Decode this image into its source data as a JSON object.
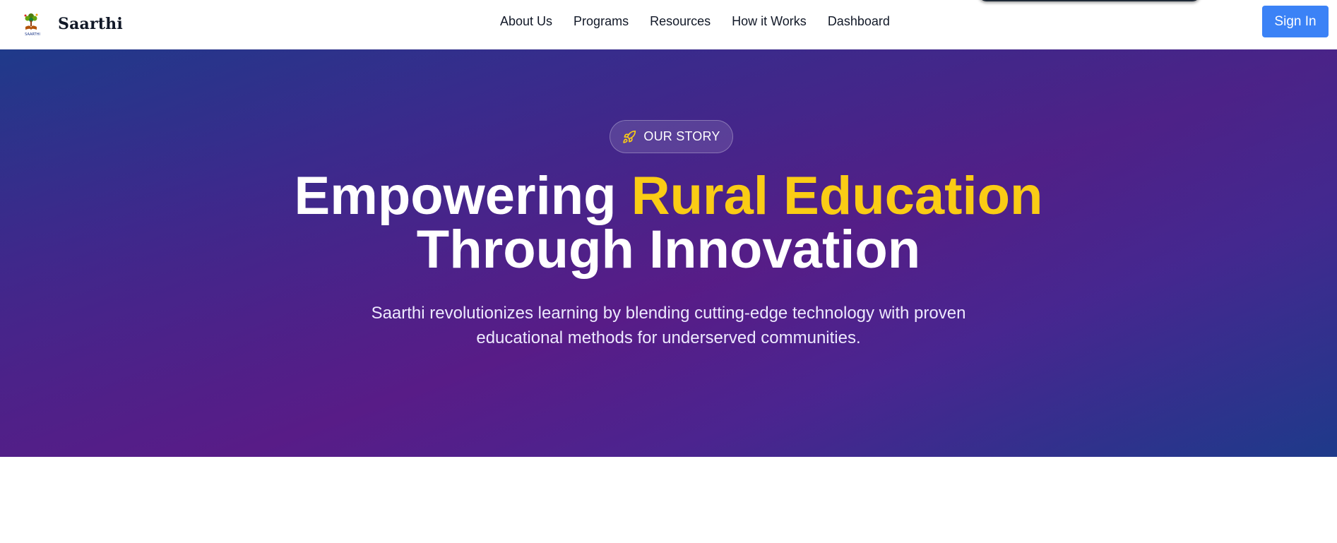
{
  "brand": {
    "name": "Saarthi",
    "logo_icon": "tree-book-logo",
    "logo_caption": "SAARTHI"
  },
  "nav": {
    "items": [
      {
        "label": "About Us"
      },
      {
        "label": "Programs"
      },
      {
        "label": "Resources"
      },
      {
        "label": "How it Works"
      },
      {
        "label": "Dashboard"
      }
    ],
    "signin_label": "Sign In"
  },
  "hero": {
    "badge_icon": "rocket-icon",
    "badge_text": "OUR STORY",
    "headline_part1": "Empowering ",
    "headline_highlight": "Rural Education",
    "headline_line2": "Through Innovation",
    "subtext_line1": "Saarthi revolutionizes learning by blending cutting-edge technology with proven",
    "subtext_line2": "educational methods for underserved communities."
  },
  "colors": {
    "accent": "#3b82f6",
    "highlight": "#facc15",
    "hero_start": "#1f3a8a",
    "hero_mid": "#581c87",
    "text_dark": "#111827"
  }
}
